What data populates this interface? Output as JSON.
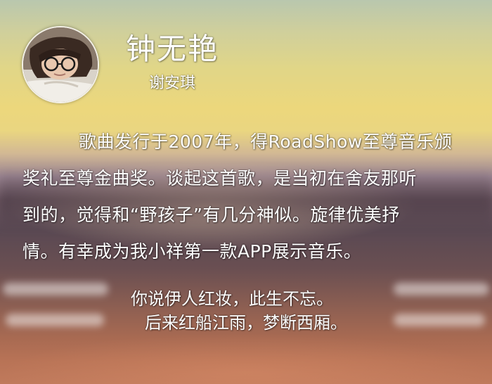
{
  "artist": {
    "song_title": "钟无艳",
    "singer": "谢安琪"
  },
  "description": {
    "lines": [
      "歌曲发行于2007年，得RoadShow至尊音乐颁",
      "奖礼至尊金曲奖。谈起这首歌，是当初在舍友那听",
      "到的，觉得和“野孩子”有几分神似。旋律优美抒",
      "情。有幸成为我小祥第一款APP展示音乐。"
    ]
  },
  "lyrics": {
    "lines": [
      "你说伊人红妆，此生不忘。",
      "后来红船江雨，梦断西厢。"
    ]
  },
  "avatar": {
    "icon": "portrait-photo"
  }
}
